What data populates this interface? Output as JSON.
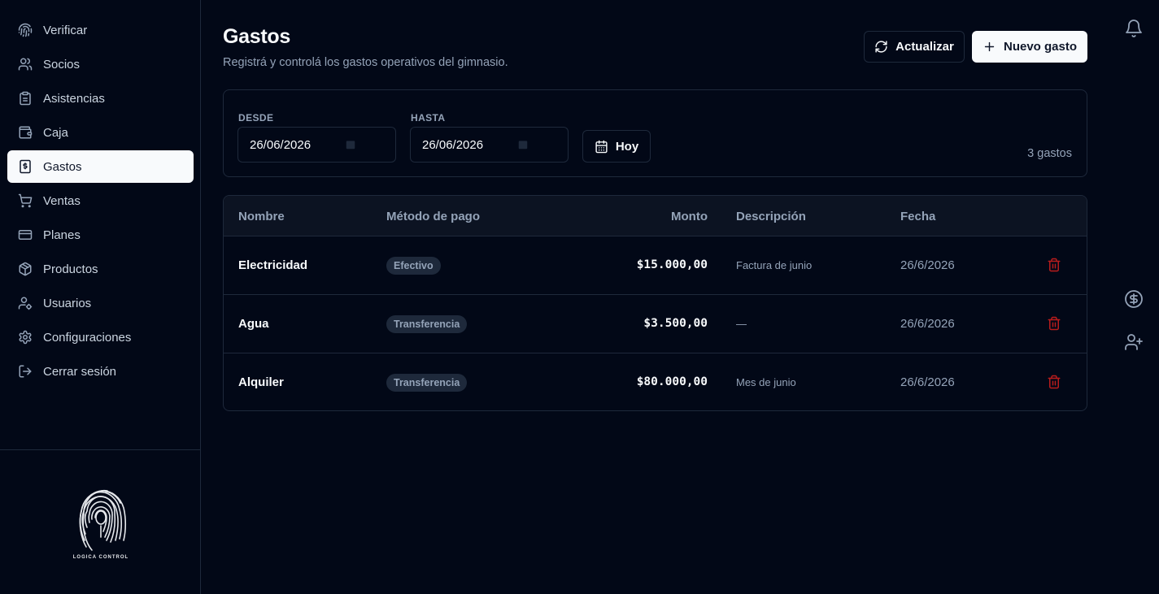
{
  "sidebar": {
    "items": [
      {
        "label": "Verificar",
        "icon": "fingerprint-icon"
      },
      {
        "label": "Socios",
        "icon": "users-icon"
      },
      {
        "label": "Asistencias",
        "icon": "clipboard-icon"
      },
      {
        "label": "Caja",
        "icon": "wallet-icon"
      },
      {
        "label": "Gastos",
        "icon": "receipt-icon",
        "active": true
      },
      {
        "label": "Ventas",
        "icon": "cart-icon"
      },
      {
        "label": "Planes",
        "icon": "credit-card-icon"
      },
      {
        "label": "Productos",
        "icon": "package-icon"
      },
      {
        "label": "Usuarios",
        "icon": "user-cog-icon"
      },
      {
        "label": "Configuraciones",
        "icon": "gear-icon"
      },
      {
        "label": "Cerrar sesión",
        "icon": "logout-icon"
      }
    ],
    "logo_text": "LOGICA CONTROL"
  },
  "header": {
    "title": "Gastos",
    "subtitle": "Registrá y controlá los gastos operativos del gimnasio.",
    "refresh_label": "Actualizar",
    "new_label": "Nuevo gasto"
  },
  "filters": {
    "from_label": "DESDE",
    "from_value": "26/06/2026",
    "to_label": "HASTA",
    "to_value": "26/06/2026",
    "today_label": "Hoy",
    "count": "3 gastos"
  },
  "table": {
    "columns": [
      "Nombre",
      "Método de pago",
      "Monto",
      "Descripción",
      "Fecha"
    ],
    "rows": [
      {
        "name": "Electricidad",
        "method": "Efectivo",
        "amount": "$15.000,00",
        "description": "Factura de junio",
        "date": "26/6/2026"
      },
      {
        "name": "Agua",
        "method": "Transferencia",
        "amount": "$3.500,00",
        "description": "—",
        "date": "26/6/2026"
      },
      {
        "name": "Alquiler",
        "method": "Transferencia",
        "amount": "$80.000,00",
        "description": "Mes de junio",
        "date": "26/6/2026"
      }
    ]
  },
  "rail": {
    "icons": [
      "bell-icon",
      "dollar-circle-icon",
      "user-plus-icon"
    ]
  },
  "colors": {
    "background": "#020817",
    "border": "#1e293b",
    "muted": "#94a3b8",
    "foreground": "#f8fafc",
    "danger": "#b91c1c"
  }
}
